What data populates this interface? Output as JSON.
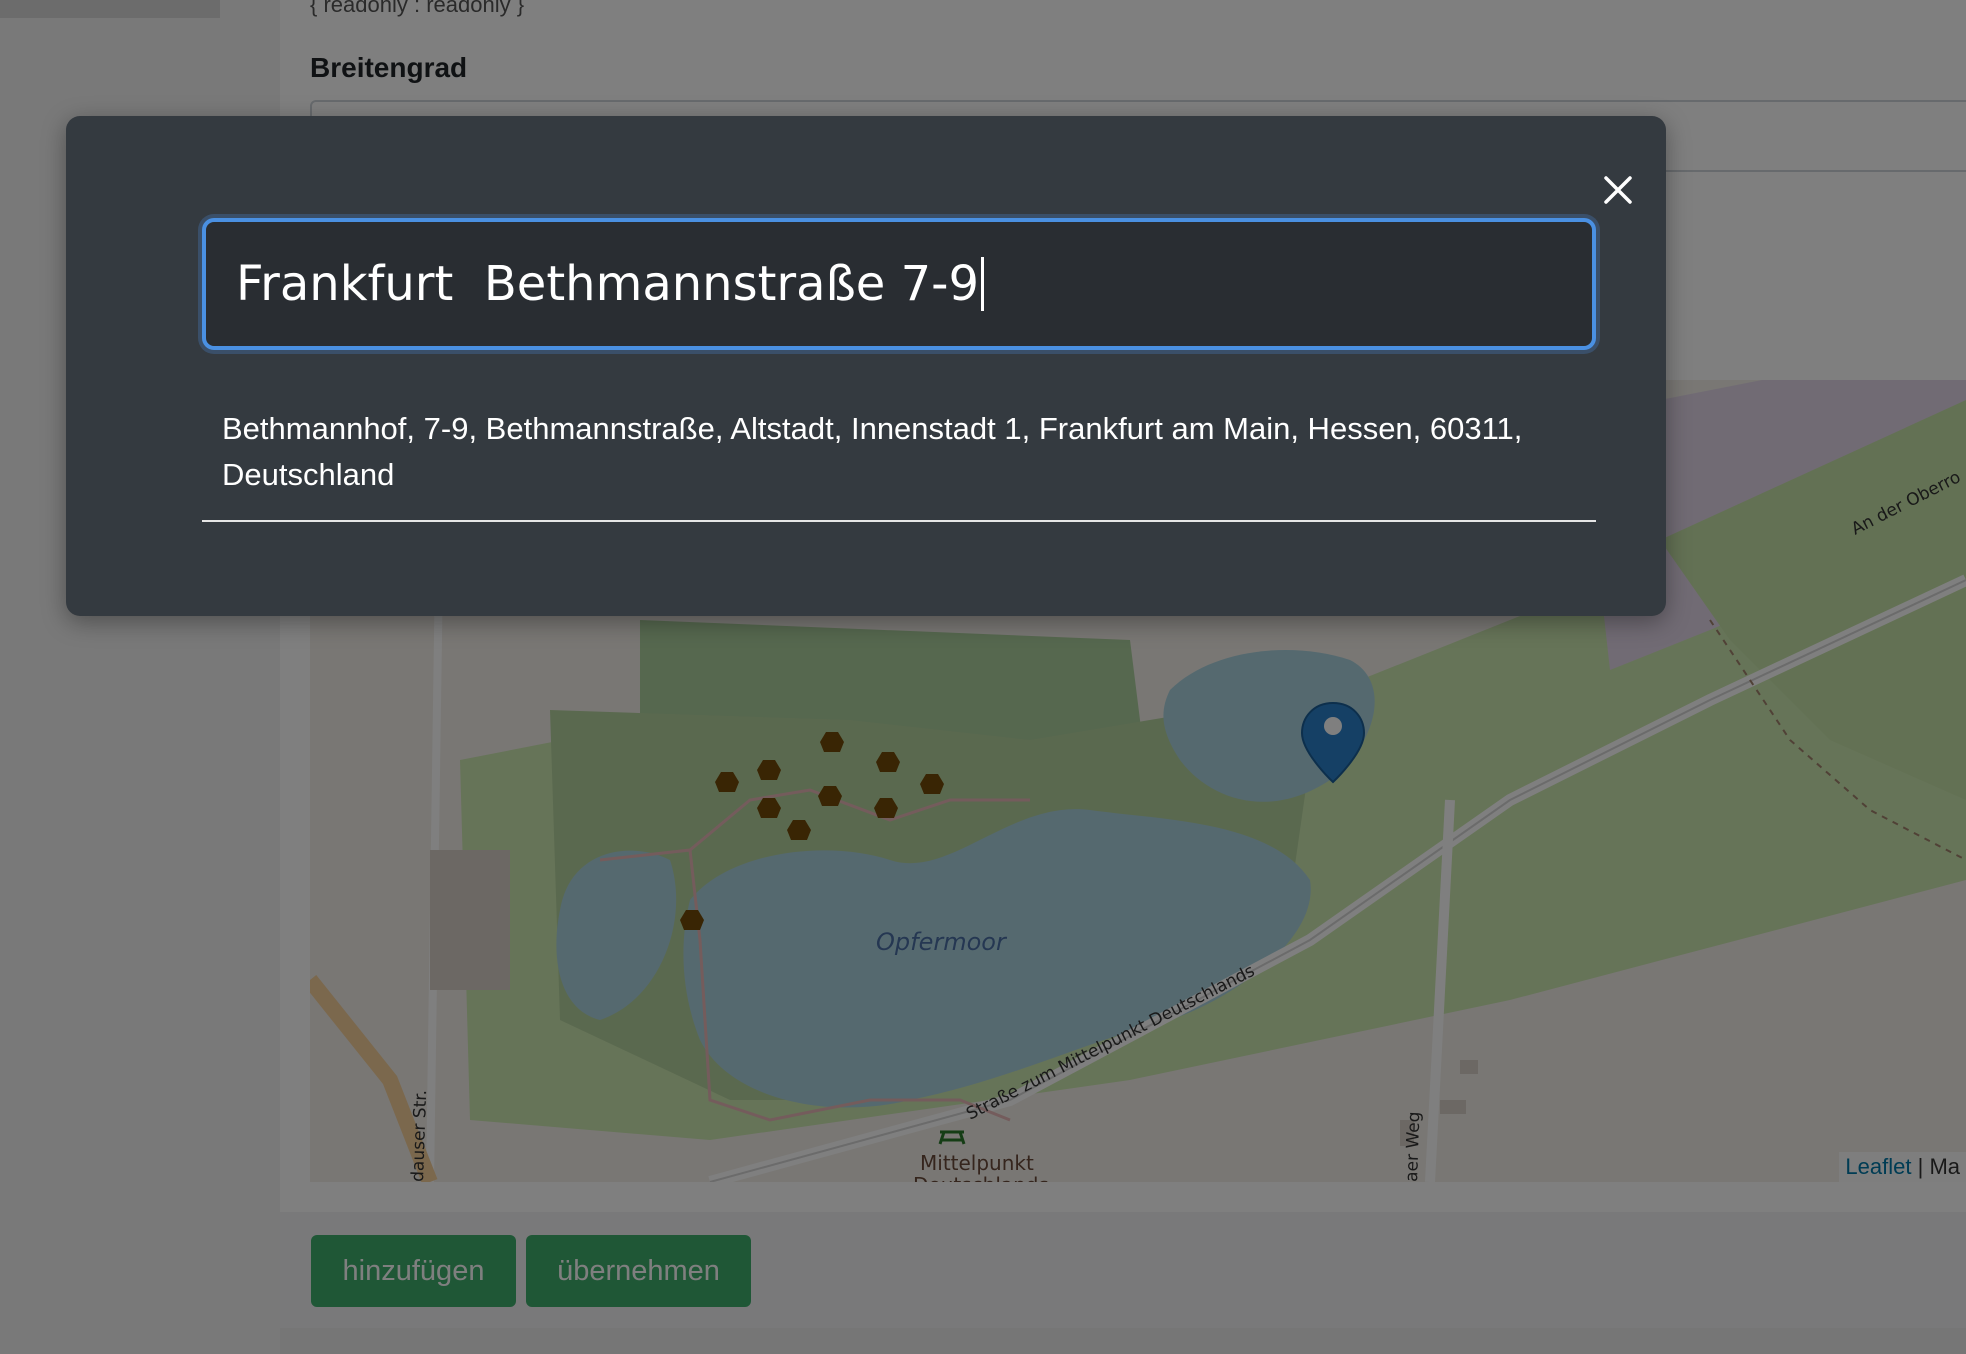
{
  "page": {
    "readonly_text": "{ readonly : readonly }",
    "field_label": "Breitengrad"
  },
  "map": {
    "labels": {
      "lake": "Opfermoor",
      "road_main": "Straße zum Mittelpunkt Deutschlands",
      "road_top_right": "An der Oberro",
      "street_left": "dauser Str.",
      "street_bottom": "aer Weg",
      "poi": "Mittelpunkt",
      "poi_sub": "Deutschlands"
    },
    "attribution": {
      "leaflet": "Leaflet",
      "separator": " | ",
      "rest": "Ma"
    },
    "marker_icon": "map-marker-icon",
    "poi_icon": "picnic-table-icon",
    "archaeological_icon": "amphora-icon"
  },
  "footer": {
    "add_label": "hinzufügen",
    "apply_label": "übernehmen"
  },
  "modal": {
    "close_icon": "close-icon",
    "search_value": "Frankfurt  Bethmannstraße 7-9",
    "results": [
      "Bethmannhof, 7-9, Bethmannstraße, Altstadt, Innenstadt 1, Frankfurt am Main, Hessen, 60311, Deutschland"
    ]
  },
  "colors": {
    "modal_bg": "#343a40",
    "input_focus": "#4a90e2",
    "button_green": "#3fae6d",
    "water": "#aad3df",
    "wood": "#c8e0b4"
  }
}
